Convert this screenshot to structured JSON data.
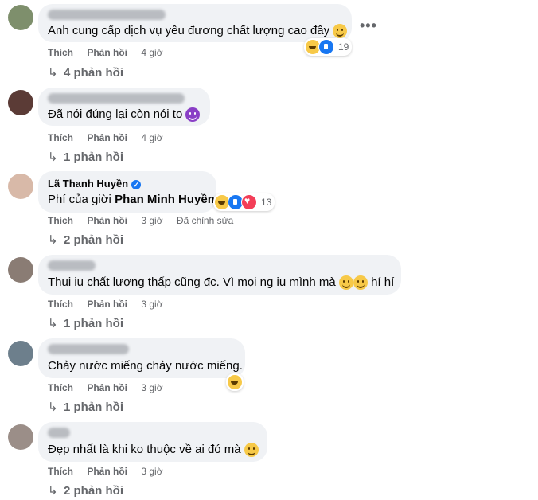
{
  "comments": [
    {
      "author": "",
      "text": "Anh cung cấp dịch vụ yêu đương chất lượng cao đây",
      "actions": {
        "like": "Thích",
        "reply": "Phản hồi",
        "time": "4 giờ",
        "edited": ""
      },
      "reactions": {
        "count": "19",
        "types": [
          "haha",
          "like"
        ]
      },
      "replies": "4 phản hồi",
      "emoji": "relieved-face-emoji"
    },
    {
      "author": "",
      "text": "Đã nói đúng lại còn nói to",
      "actions": {
        "like": "Thích",
        "reply": "Phản hồi",
        "time": "4 giờ",
        "edited": ""
      },
      "reactions": null,
      "replies": "1 phản hồi",
      "emoji": "smiling-devil-emoji"
    },
    {
      "author": "Lã Thanh Huyền",
      "text_prefix": "Phí của giời",
      "mention": "Phan Minh Huyền",
      "actions": {
        "like": "Thích",
        "reply": "Phản hồi",
        "time": "3 giờ",
        "edited": "Đã chỉnh sửa"
      },
      "reactions": {
        "count": "13",
        "types": [
          "haha",
          "like",
          "love"
        ]
      },
      "replies": "2 phản hồi"
    },
    {
      "author": "",
      "text": "Thui iu chất lượng thấp cũng đc. Vì mọi ng iu mình mà",
      "text_suffix": "hí hí",
      "actions": {
        "like": "Thích",
        "reply": "Phản hồi",
        "time": "3 giờ",
        "edited": ""
      },
      "reactions": null,
      "replies": "1 phản hồi"
    },
    {
      "author": "",
      "text": "Chảy nước miếng chảy nước miếng.",
      "actions": {
        "like": "Thích",
        "reply": "Phản hồi",
        "time": "3 giờ",
        "edited": ""
      },
      "reactions": {
        "count": "",
        "types": [
          "haha"
        ]
      },
      "replies": "1 phản hồi"
    },
    {
      "author": "",
      "text": "Đẹp nhất là khi ko thuộc về ai đó mà",
      "actions": {
        "like": "Thích",
        "reply": "Phản hồi",
        "time": "3 giờ",
        "edited": ""
      },
      "reactions": null,
      "replies": "2 phản hồi",
      "emoji": "grinning-face-emoji"
    }
  ],
  "icons": {
    "more": "more-options-icon",
    "reply_arrow": "reply-arrow-icon",
    "verified": "verified-badge-icon"
  },
  "colors": {
    "bubble": "#f0f2f5",
    "meta": "#65676b",
    "like": "#1877f2",
    "love": "#f33e58"
  }
}
